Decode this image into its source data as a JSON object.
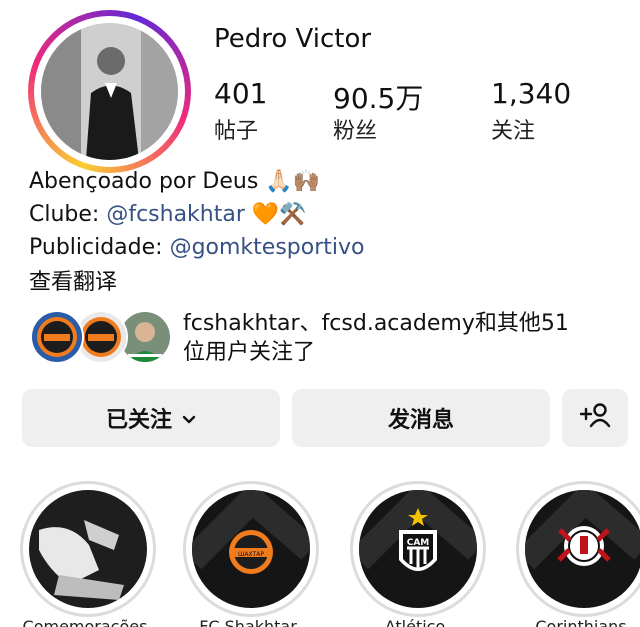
{
  "profile": {
    "username": "Pedro Victor",
    "stats": [
      {
        "value": "401",
        "label": "帖子"
      },
      {
        "value": "90.5万",
        "label": "粉丝"
      },
      {
        "value": "1,340",
        "label": "关注"
      }
    ]
  },
  "bio": {
    "line1": "Abençoado por Deus",
    "line1_emoji": "🙏🏻🙌🏽",
    "line2_prefix": "Clube: ",
    "line2_mention": "@fcshakhtar",
    "line2_emoji": "🧡⚒️",
    "line3_prefix": "Publicidade: ",
    "line3_mention": "@gomktesportivo",
    "translate": "查看翻译"
  },
  "mutual": {
    "text_line1": "fcshakhtar、fcsd.academy和其他51",
    "text_line2": "位用户关注了",
    "badge_text": "ШАХТАР"
  },
  "buttons": {
    "following": "已关注",
    "message": "发消息"
  },
  "highlights": [
    {
      "label": "Comemorações"
    },
    {
      "label": "FC Shakhtar",
      "badge": "ШАХТАР"
    },
    {
      "label": "Atlético",
      "badge": "CAM"
    },
    {
      "label": "Corinthians"
    }
  ],
  "colors": {
    "mention": "#385185",
    "button_bg": "#efefef",
    "shakhtar_orange": "#f07c1e"
  }
}
